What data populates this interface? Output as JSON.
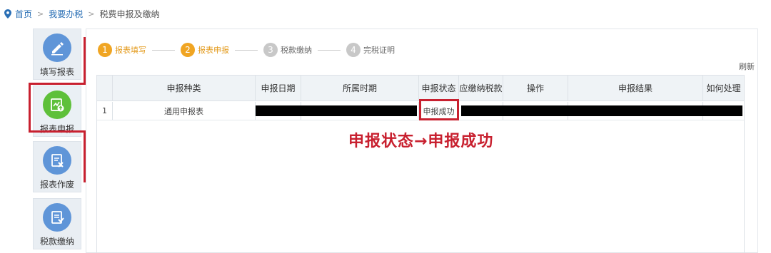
{
  "breadcrumb": {
    "home": "首页",
    "section": "我要办税",
    "current": "税费申报及缴纳"
  },
  "sidebar": {
    "items": [
      {
        "label": "填写报表",
        "icon": "pencil-icon"
      },
      {
        "label": "报表申报",
        "icon": "report-upload-icon"
      },
      {
        "label": "报表作废",
        "icon": "report-void-icon"
      },
      {
        "label": "税款缴纳",
        "icon": "tax-payment-icon"
      }
    ]
  },
  "steps": [
    {
      "num": "1",
      "label": "报表填写",
      "state": "done"
    },
    {
      "num": "2",
      "label": "报表申报",
      "state": "current"
    },
    {
      "num": "3",
      "label": "税款缴纳",
      "state": "pending"
    },
    {
      "num": "4",
      "label": "完税证明",
      "state": "pending"
    }
  ],
  "toolbar": {
    "refresh": "刷新"
  },
  "table": {
    "headers": [
      "",
      "申报种类",
      "申报日期",
      "所属时期",
      "申报状态",
      "应缴纳税款",
      "操作",
      "申报结果",
      "如何处理"
    ],
    "rows": [
      {
        "index": "1",
        "type": "通用申报表",
        "status": "申报成功"
      }
    ]
  },
  "annotation": "申报状态→申报成功",
  "colors": {
    "highlight_red": "#c8202f",
    "step_active": "#f0a523",
    "link_blue": "#2a6fb5",
    "icon_blue": "#5f95d8",
    "icon_green": "#5ec03a"
  }
}
